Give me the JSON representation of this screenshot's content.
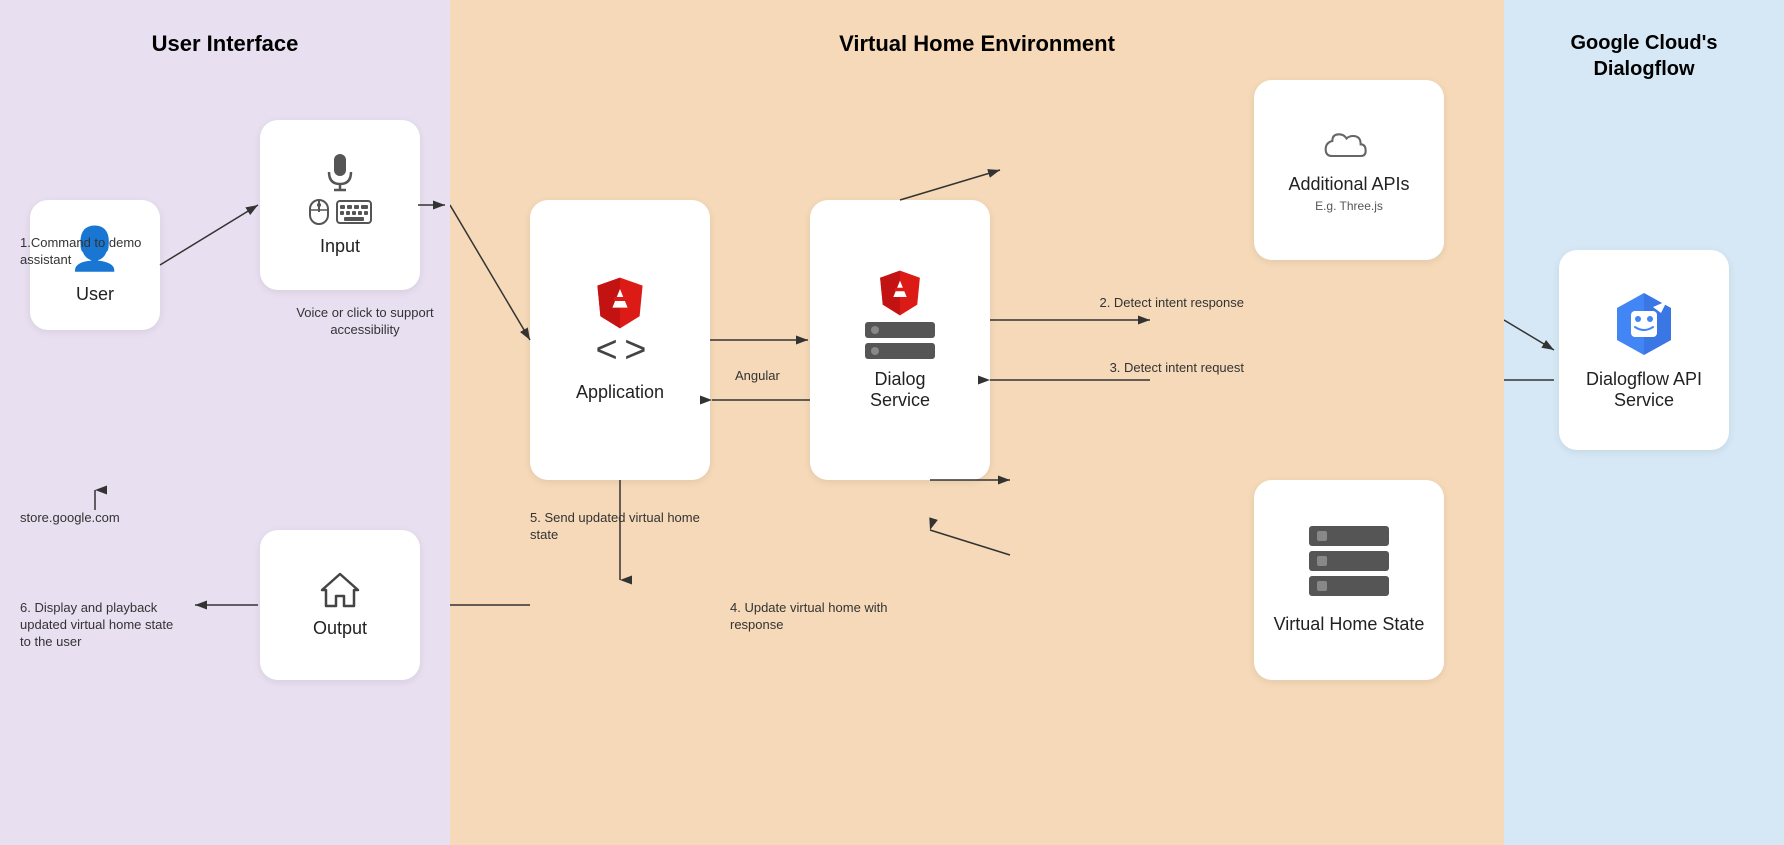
{
  "sections": {
    "userInterface": {
      "title": "User Interface",
      "bgColor": "#e8dff0"
    },
    "virtualHome": {
      "title": "Virtual Home Environment",
      "bgColor": "#f5d9b8"
    },
    "googleCloud": {
      "title": "Google Cloud's\nDialogflow",
      "bgColor": "#d6e8f5"
    }
  },
  "cards": {
    "user": {
      "label": "User"
    },
    "input": {
      "label": "Input"
    },
    "output": {
      "label": "Output"
    },
    "application": {
      "label": "Application"
    },
    "dialogService": {
      "label": "Dialog\nService"
    },
    "additionalAPIs": {
      "label": "Additional\nAPIs",
      "sublabel": "E.g. Three.js"
    },
    "virtualHomeState": {
      "label": "Virtual\nHome State"
    },
    "dialogflowAPI": {
      "label": "Dialogflow\nAPI Service"
    }
  },
  "arrows": {
    "a1": "1.Command to demo\nassistant",
    "a2": "Voice or click to\nsupport accessibility",
    "a3": "Angular",
    "a4": "2. Detect intent response",
    "a5": "3. Detect intent request",
    "a6": "4. Update virtual home\nwith response",
    "a7": "5. Send updated virtual\nhome state",
    "a8": "store.google.com",
    "a9": "6. Display and playback\nupdated virtual home\nstate to the user"
  }
}
